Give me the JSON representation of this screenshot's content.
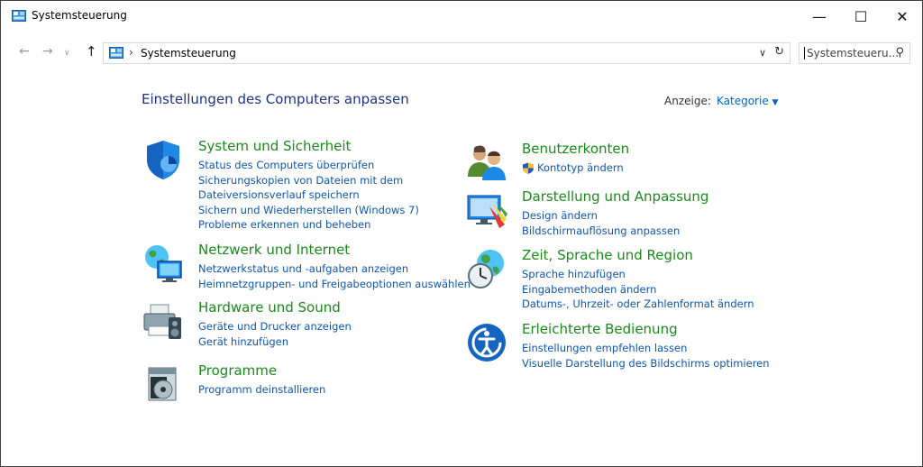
{
  "window": {
    "title": "Systemsteuerung",
    "controls": {
      "minimize": "—",
      "maximize": "☐",
      "close": "✕"
    }
  },
  "navigation": {
    "back_icon": "arrow-left-icon",
    "forward_icon": "arrow-right-icon",
    "up_icon": "arrow-up-icon",
    "breadcrumb": "Systemsteuerung",
    "search_placeholder": "Systemsteueru..."
  },
  "main": {
    "heading": "Einstellungen des Computers anpassen",
    "view_label": "Anzeige:",
    "view_value": "Kategorie"
  },
  "categories_left": [
    {
      "title": "System und Sicherheit",
      "icon": "shield-icon",
      "links": [
        "Status des Computers überprüfen",
        "Sicherungskopien von Dateien mit dem",
        "Dateiversionsverlauf speichern",
        "Sichern und Wiederherstellen (Windows 7)",
        "Probleme erkennen und beheben"
      ]
    },
    {
      "title": "Netzwerk und Internet",
      "icon": "network-globe-icon",
      "links": [
        "Netzwerkstatus und -aufgaben anzeigen",
        "Heimnetzgruppen- und Freigabeoptionen auswählen"
      ]
    },
    {
      "title": "Hardware und Sound",
      "icon": "printer-speaker-icon",
      "links": [
        "Geräte und Drucker anzeigen",
        "Gerät hinzufügen"
      ]
    },
    {
      "title": "Programme",
      "icon": "programs-disc-icon",
      "links": [
        "Programm deinstallieren"
      ]
    }
  ],
  "categories_right": [
    {
      "title": "Benutzerkonten",
      "icon": "users-icon",
      "links": [
        "Kontotyp ändern"
      ]
    },
    {
      "title": "Darstellung und Anpassung",
      "icon": "appearance-monitor-icon",
      "links": [
        "Design ändern",
        "Bildschirmauflösung anpassen"
      ]
    },
    {
      "title": "Zeit, Sprache und Region",
      "icon": "clock-globe-icon",
      "links": [
        "Sprache hinzufügen",
        "Eingabemethoden ändern",
        "Datums-, Uhrzeit- oder Zahlenformat ändern"
      ]
    },
    {
      "title": "Erleichterte Bedienung",
      "icon": "ease-of-access-icon",
      "links": [
        "Einstellungen empfehlen lassen",
        "Visuelle Darstellung des Bildschirms optimieren"
      ]
    }
  ],
  "colors": {
    "heading": "#1e3287",
    "category_title": "#1b8a1b",
    "link": "#0f56b0"
  }
}
